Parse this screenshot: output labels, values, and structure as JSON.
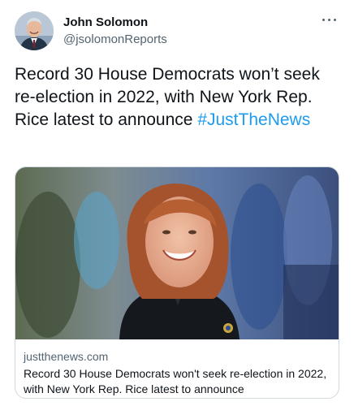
{
  "author": {
    "display_name": "John Solomon",
    "handle": "@jsolomonReports",
    "avatar_icon": "person-avatar"
  },
  "menu": {
    "icon": "more-horizontal-icon"
  },
  "tweet": {
    "text": "Record 30 House Democrats won’t seek re-election in 2022, with New York Rep. Rice latest to announce",
    "hashtag": "#JustTheNews"
  },
  "link_card": {
    "domain": "justthenews.com",
    "title": "Record 30 House Democrats won't seek re-election in 2022, with New York Rep. Rice latest to announce",
    "image_icon": "news-photo"
  },
  "colors": {
    "link": "#1d9bf0",
    "text_primary": "#0f1419",
    "text_secondary": "#536471",
    "border": "#cfd9de"
  }
}
